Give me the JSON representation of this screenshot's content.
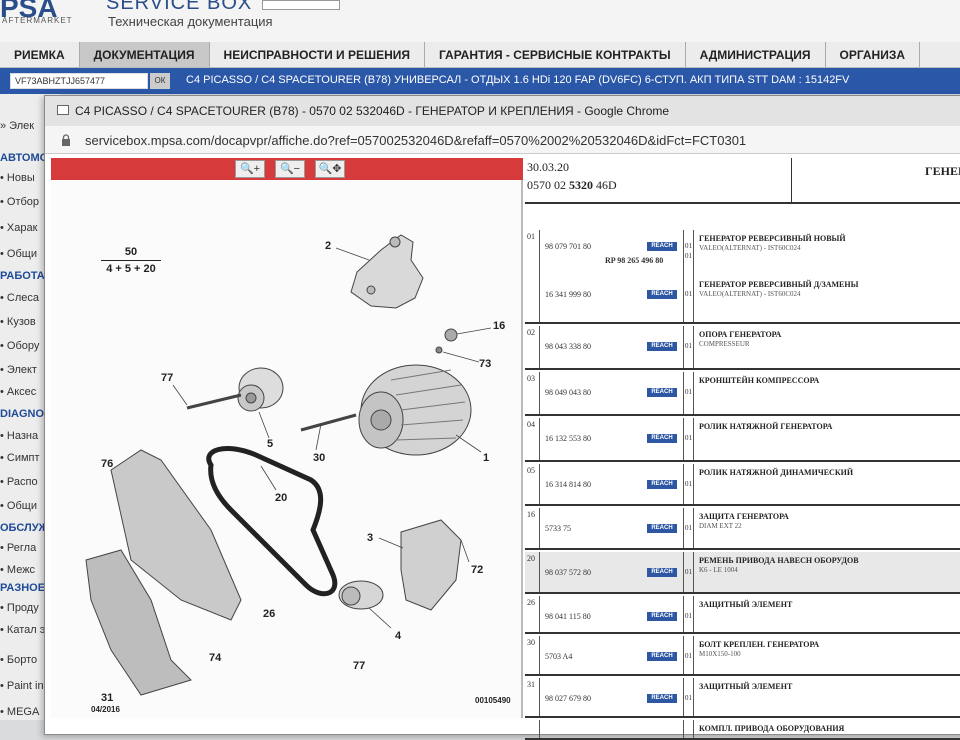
{
  "app": {
    "logo": "PSA",
    "logo_sub": "AFTERMARKET",
    "title": "SERVICE BOX",
    "subtitle": "Техническая документация"
  },
  "nav": {
    "items": [
      "РИЕМКА",
      "ДОКУМЕНТАЦИЯ",
      "НЕИСПРАВНОСТИ И РЕШЕНИЯ",
      "ГАРАНТИЯ - СЕРВИСНЫЕ КОНТРАКТЫ",
      "АДМИНИСТРАЦИЯ",
      "ОРГАНИЗА"
    ]
  },
  "vehicle": {
    "vin": "VF73ABHZTJJ657477",
    "ok_label": "ОК",
    "description": "C4 PICASSO / C4 SPACETOURER (B78) УНИВЕРСАЛ - ОТДЫХ 1.6 HDi 120 FAP (DV6FC) 6-СТУП. АКП ТИПА STT  DAM : 15142FV"
  },
  "sidebar": {
    "items": [
      {
        "type": "item",
        "label": "» Элек"
      },
      {
        "type": "section",
        "label": "АВТОМО"
      },
      {
        "type": "item",
        "label": "• Новы"
      },
      {
        "type": "item",
        "label": "• Отбор"
      },
      {
        "type": "item",
        "label": "• Харак"
      },
      {
        "type": "item",
        "label": "• Общи"
      },
      {
        "type": "section",
        "label": "РАБОТА"
      },
      {
        "type": "item",
        "label": "• Слеса"
      },
      {
        "type": "item",
        "label": "• Кузов"
      },
      {
        "type": "item",
        "label": "• Обору"
      },
      {
        "type": "item",
        "label": "• Элект"
      },
      {
        "type": "item",
        "label": "• Аксес"
      },
      {
        "type": "section",
        "label": "DIAGNO"
      },
      {
        "type": "item",
        "label": "• Назна"
      },
      {
        "type": "item",
        "label": "• Симпт"
      },
      {
        "type": "item",
        "label": "• Распо"
      },
      {
        "type": "item",
        "label": "• Общи"
      },
      {
        "type": "section",
        "label": "ОБСЛУЖ"
      },
      {
        "type": "item",
        "label": "• Регла"
      },
      {
        "type": "item",
        "label": "• Межс"
      },
      {
        "type": "section",
        "label": "РАЗНОЕ"
      },
      {
        "type": "item",
        "label": "• Проду"
      },
      {
        "type": "item",
        "label": "• Катал элеме"
      },
      {
        "type": "item",
        "label": "• Борто"
      },
      {
        "type": "item",
        "label": "• Paint inform"
      },
      {
        "type": "item",
        "label": "• MEGA"
      }
    ]
  },
  "popup": {
    "title": "C4 PICASSO / C4 SPACETOURER (B78) - 0570 02 532046D - ГЕНЕРАТОР И КРЕПЛЕНИЯ - Google Chrome",
    "url": "servicebox.mpsa.com/docapvpr/affiche.do?ref=057002532046D&refaff=0570%2002%20532046D&idFct=FCT0301"
  },
  "diagram": {
    "zoom_in": "🔍+",
    "zoom_out": "🔍−",
    "zoom_move": "🔍✥",
    "fraction_top": "50",
    "fraction_bottom": "4 + 5 + 20",
    "labels": [
      {
        "id": "2",
        "text": "2"
      },
      {
        "id": "16",
        "text": "16"
      },
      {
        "id": "73",
        "text": "73"
      },
      {
        "id": "77a",
        "text": "77"
      },
      {
        "id": "5",
        "text": "5"
      },
      {
        "id": "30",
        "text": "30"
      },
      {
        "id": "1",
        "text": "1"
      },
      {
        "id": "76",
        "text": "76"
      },
      {
        "id": "20",
        "text": "20"
      },
      {
        "id": "3",
        "text": "3"
      },
      {
        "id": "72",
        "text": "72"
      },
      {
        "id": "26",
        "text": "26"
      },
      {
        "id": "74",
        "text": "74"
      },
      {
        "id": "4",
        "text": "4"
      },
      {
        "id": "77b",
        "text": "77"
      },
      {
        "id": "31",
        "text": "31"
      }
    ],
    "date": "04/2016",
    "ref": "00105490"
  },
  "parts": {
    "header_date": "30.03.20",
    "header_ref_a": "0570 02 ",
    "header_ref_b": "5320",
    "header_ref_c": " 46D",
    "header_title": "ГЕНЕРА",
    "reach_label": "REACH",
    "rows": [
      {
        "num": "01",
        "refs": [
          "98 079 701 80",
          "RP 98 265 496 80",
          "16 341 999 80"
        ],
        "qty": [
          "01",
          "01",
          "01"
        ],
        "names": [
          "ГЕНЕРАТОР РЕВЕРСИВНЫЙ НОВЫЙ",
          "ГЕНЕРАТОР РЕВЕРСИВНЫЙ Д/ЗАМЕНЫ"
        ],
        "descs": [
          "VALEO(ALTERNAT) - IST60C024",
          "VALEO(ALTERNAT) - IST60C024"
        ]
      },
      {
        "num": "02",
        "refs": [
          "98 043 338 80"
        ],
        "qty": [
          "01"
        ],
        "names": [
          "ОПОРА ГЕНЕРАТОРА"
        ],
        "descs": [
          "COMPRESSEUR"
        ]
      },
      {
        "num": "03",
        "refs": [
          "98 049 043 80"
        ],
        "qty": [
          "01"
        ],
        "names": [
          "КРОНШТЕЙН КОМПРЕССОРА"
        ],
        "descs": [
          ""
        ]
      },
      {
        "num": "04",
        "refs": [
          "16 132 553 80"
        ],
        "qty": [
          "01"
        ],
        "names": [
          "РОЛИК НАТЯЖНОЙ ГЕНЕРАТОРА"
        ],
        "descs": [
          ""
        ]
      },
      {
        "num": "05",
        "refs": [
          "16 314 814 80"
        ],
        "qty": [
          "01"
        ],
        "names": [
          "РОЛИК НАТЯЖНОЙ ДИНАМИЧЕСКИЙ"
        ],
        "descs": [
          ""
        ]
      },
      {
        "num": "16",
        "refs": [
          "5733 75"
        ],
        "qty": [
          "01"
        ],
        "names": [
          "ЗАЩИТА ГЕНЕРАТОРА"
        ],
        "descs": [
          "DIAM EXT 22"
        ]
      },
      {
        "num": "20",
        "refs": [
          "98 037 572 80"
        ],
        "qty": [
          "01"
        ],
        "names": [
          "РЕМЕНЬ ПРИВОДА НАВЕСН ОБОРУДОВ"
        ],
        "descs": [
          "K6 - LE 1004"
        ]
      },
      {
        "num": "26",
        "refs": [
          "98 041 115 80"
        ],
        "qty": [
          "01"
        ],
        "names": [
          "ЗАЩИТНЫЙ ЭЛЕМЕНТ"
        ],
        "descs": [
          ""
        ]
      },
      {
        "num": "30",
        "refs": [
          "5703 A4"
        ],
        "qty": [
          "01"
        ],
        "names": [
          "БОЛТ КРЕПЛЕН. ГЕНЕРАТОРА"
        ],
        "descs": [
          "M10X150-100"
        ]
      },
      {
        "num": "31",
        "refs": [
          "98 027 679 80"
        ],
        "qty": [
          "01"
        ],
        "names": [
          "ЗАЩИТНЫЙ ЭЛЕМЕНТ"
        ],
        "descs": [
          ""
        ]
      },
      {
        "num": "",
        "refs": [
          ""
        ],
        "qty": [
          ""
        ],
        "names": [
          "КОМПЛ. ПРИВОДА ОБОРУДОВАНИЯ"
        ],
        "descs": [
          ""
        ]
      }
    ]
  }
}
